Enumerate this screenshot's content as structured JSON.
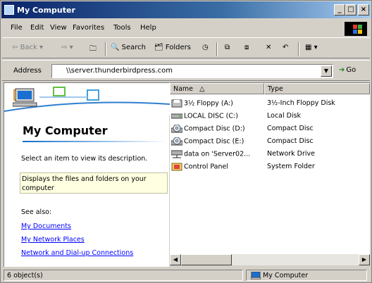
{
  "window": {
    "title": "My Computer"
  },
  "title_buttons": {
    "minimize": "_",
    "maximize": "□",
    "close": "×"
  },
  "menu": [
    "File",
    "Edit",
    "View",
    "Favorites",
    "Tools",
    "Help"
  ],
  "toolbar": {
    "back": "Back",
    "search": "Search",
    "folders": "Folders"
  },
  "address": {
    "label": "Address",
    "value": "\\\\server.thunderbirdpress.com",
    "go": "Go"
  },
  "left_pane": {
    "title": "My Computer",
    "prompt": "Select an item to view its description.",
    "description": "Displays the files and folders on your computer",
    "see_also": "See also:",
    "links": [
      "My Documents",
      "My Network Places",
      "Network and Dial-up Connections"
    ]
  },
  "columns": {
    "name": "Name",
    "type": "Type"
  },
  "items": [
    {
      "name": "3½ Floppy (A:)",
      "type": "3½-Inch Floppy Disk",
      "icon": "floppy-icon"
    },
    {
      "name": "LOCAL DISC (C:)",
      "type": "Local Disk",
      "icon": "harddisk-icon"
    },
    {
      "name": "Compact Disc (D:)",
      "type": "Compact Disc",
      "icon": "cd-icon"
    },
    {
      "name": "Compact Disc (E:)",
      "type": "Compact Disc",
      "icon": "cd-icon"
    },
    {
      "name": "data on 'Server02...",
      "type": "Network Drive",
      "icon": "network-drive-icon"
    },
    {
      "name": "Control Panel",
      "type": "System Folder",
      "icon": "control-panel-icon"
    }
  ],
  "status": {
    "objects": "6 object(s)",
    "location": "My Computer"
  },
  "colors": {
    "title_gradient_start": "#0a246a",
    "link": "#0000ff",
    "info_bg": "#ffffe1"
  }
}
